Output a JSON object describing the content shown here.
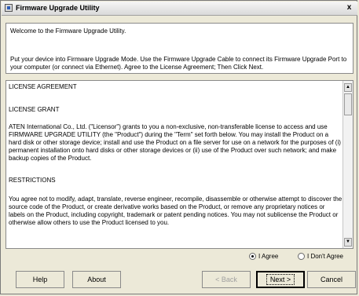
{
  "window": {
    "title": "Firmware Upgrade Utility",
    "close_label": "x"
  },
  "intro": {
    "welcome": "Welcome to the Firmware Upgrade Utility.",
    "instructions": "Put your device into Firmware Upgrade Mode. Use the Firmware Upgrade Cable to connect its Firmware Upgrade Port to your computer (or connect via Ethernet). Agree to the License Agreement; Then Click Next."
  },
  "license": {
    "agreement_title": "LICENSE AGREEMENT",
    "grant_title": "LICENSE GRANT",
    "grant_text": "ATEN International Co., Ltd. (\"Licensor\") grants to you a non-exclusive, non-transferable license to access and use FIRMWARE UPGRADE UTILITY (the \"Product\") during the \"Term\" set forth below. You may install the Product on a hard disk or other storage device; install and use the Product on a file server for use on a network for the purposes of (i) permanent installation onto hard disks or other storage devices or (ii) use of the Product over such network; and make backup copies of the Product.",
    "restrictions_title": "RESTRICTIONS",
    "restrictions_text": "You agree not to modify, adapt, translate, reverse engineer, recompile, disassemble or otherwise attempt to discover the source code of the Product, or create derivative works based on the Product, or remove any proprietary notices or labels on the Product, including copyright, trademark or patent pending notices. You may not sublicense the Product or otherwise allow others to use the Product licensed to you."
  },
  "agreement": {
    "agree_label": "I Agree",
    "disagree_label": "I Don't Agree",
    "selected": "agree"
  },
  "buttons": {
    "help": "Help",
    "about": "About",
    "back": "< Back",
    "next": "Next >",
    "cancel": "Cancel"
  },
  "scrollbar": {
    "up_icon": "▲",
    "down_icon": "▼"
  }
}
